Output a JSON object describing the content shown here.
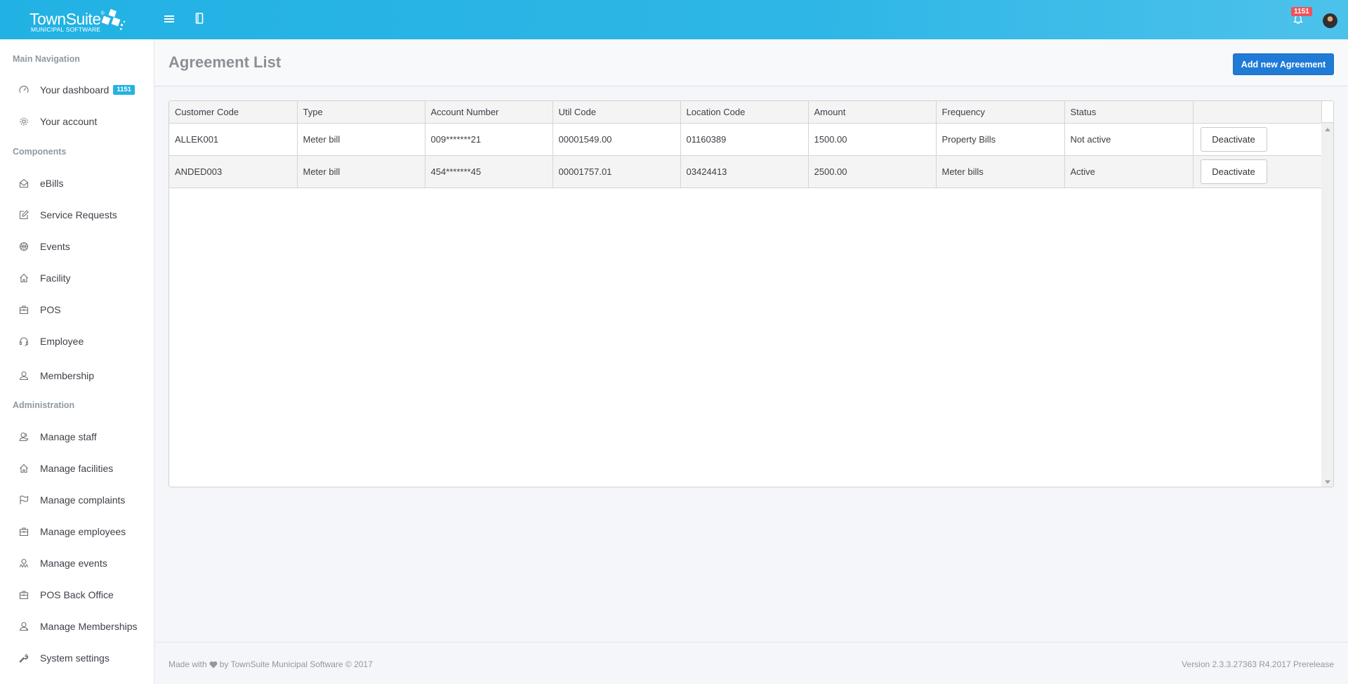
{
  "header": {
    "brand": "TownSuite",
    "brand_mark": "®",
    "brand_sub": "MUNICIPAL SOFTWARE",
    "notification_count": "1151",
    "icons": [
      "menu-icon",
      "book-icon",
      "bell-icon",
      "user-avatar"
    ]
  },
  "sidebar": {
    "sections": [
      {
        "title": "Main Navigation"
      },
      {
        "title": "Components"
      },
      {
        "title": "Administration"
      }
    ],
    "main": [
      {
        "label": "Your dashboard",
        "icon": "dashboard-icon",
        "badge": "1151"
      },
      {
        "label": "Your account",
        "icon": "gear-icon"
      }
    ],
    "components": [
      {
        "label": "eBills",
        "icon": "envelope-icon"
      },
      {
        "label": "Service Requests",
        "icon": "edit-icon"
      },
      {
        "label": "Events",
        "icon": "basketball-icon"
      },
      {
        "label": "Facility",
        "icon": "home-icon"
      },
      {
        "label": "POS",
        "icon": "briefcase-icon"
      },
      {
        "label": "Employee",
        "icon": "headset-icon"
      },
      {
        "label": "Membership",
        "icon": "user-icon"
      }
    ],
    "admin": [
      {
        "label": "Manage staff",
        "icon": "users-icon"
      },
      {
        "label": "Manage facilities",
        "icon": "home-icon"
      },
      {
        "label": "Manage complaints",
        "icon": "flag-icon"
      },
      {
        "label": "Manage employees",
        "icon": "briefcase-icon"
      },
      {
        "label": "Manage events",
        "icon": "group-icon"
      },
      {
        "label": "POS Back Office",
        "icon": "briefcase-icon"
      },
      {
        "label": "Manage Memberships",
        "icon": "user-plus-icon"
      },
      {
        "label": "System settings",
        "icon": "wrench-icon"
      }
    ]
  },
  "page": {
    "title": "Agreement List",
    "add_button": "Add new Agreement"
  },
  "table": {
    "columns": [
      "Customer Code",
      "Type",
      "Account Number",
      "Util Code",
      "Location Code",
      "Amount",
      "Frequency",
      "Status",
      ""
    ],
    "rows": [
      {
        "customer_code": "ALLEK001",
        "type": "Meter bill",
        "account_number": "009*******21",
        "util_code": "00001549.00",
        "location_code": "01160389",
        "amount": "1500.00",
        "frequency": "Property Bills",
        "status": "Not active",
        "action": "Deactivate"
      },
      {
        "customer_code": "ANDED003",
        "type": "Meter bill",
        "account_number": "454*******45",
        "util_code": "00001757.01",
        "location_code": "03424413",
        "amount": "2500.00",
        "frequency": "Meter bills",
        "status": "Active",
        "action": "Deactivate"
      }
    ]
  },
  "footer": {
    "made_with": "Made with",
    "by": "by TownSuite Municipal Software © 2017",
    "version": "Version 2.3.3.27363 R4.2017 Prerelease"
  },
  "colors": {
    "header": "#2eb6e6",
    "primary_button": "#1f7bd6",
    "badge_red": "#f0525b",
    "badge_blue": "#25b2e1"
  }
}
